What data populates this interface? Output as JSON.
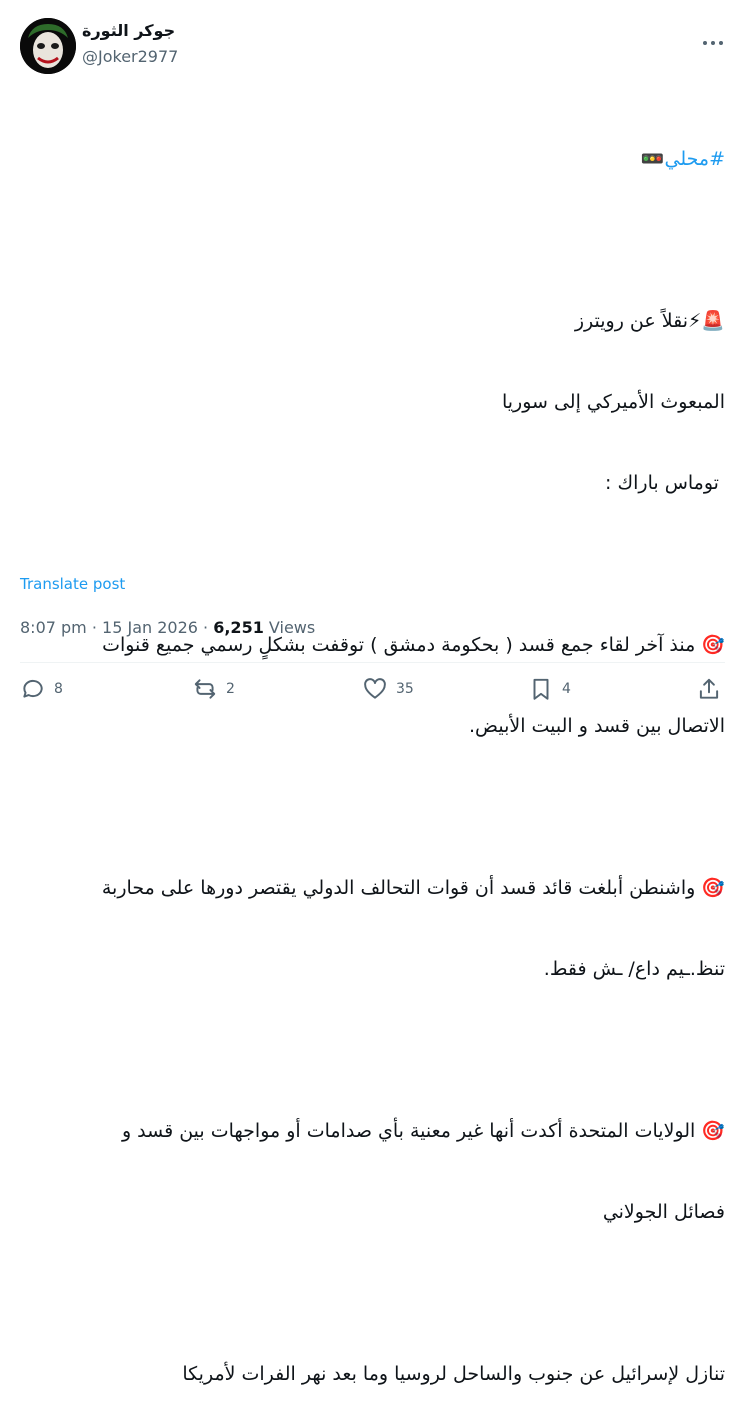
{
  "user": {
    "display_name": "جوكر الثورة",
    "handle": "@Joker2977"
  },
  "tweet": {
    "hashtag": "#محلي",
    "hashtag_emoji": "🚥",
    "lines": [
      "🚨⚡نقلاً عن رويترز",
      "المبعوث الأميركي إلى سوريا",
      " توماس باراك :",
      "",
      "🎯 منذ آخر لقاء جمع قسد ( بحكومة دمشق ) توقفت بشكلٍ رسمي جميع قنوات",
      "الاتصال بين قسد و البيت الأبيض.",
      "",
      "🎯 واشنطن أبلغت قائد قسد أن قوات التحالف الدولي يقتصر دورها على محاربة",
      "تنظ.ـيم داع/ ـش فقط.",
      "",
      "🎯 الولايات المتحدة أكدت أنها غير معنية بأي صدامات أو مواجهات بين قسد و",
      "فصائل الجولاني",
      "",
      "تنازل لإسرائيل عن جنوب والساحل لروسيا وما بعد نهر الفرات لأمريكا"
    ]
  },
  "translate_label": "Translate post",
  "meta": {
    "time": "8:07 pm",
    "sep1": " · ",
    "date": "15 Jan 2026",
    "sep2": " · ",
    "views_count": "6,251",
    "views_label": " Views"
  },
  "actions": {
    "replies": "8",
    "reposts": "2",
    "likes": "35",
    "bookmarks": "4"
  },
  "icons": [
    "avatar-joker",
    "more-icon",
    "reply-icon",
    "repost-icon",
    "like-icon",
    "bookmark-icon",
    "share-icon"
  ]
}
